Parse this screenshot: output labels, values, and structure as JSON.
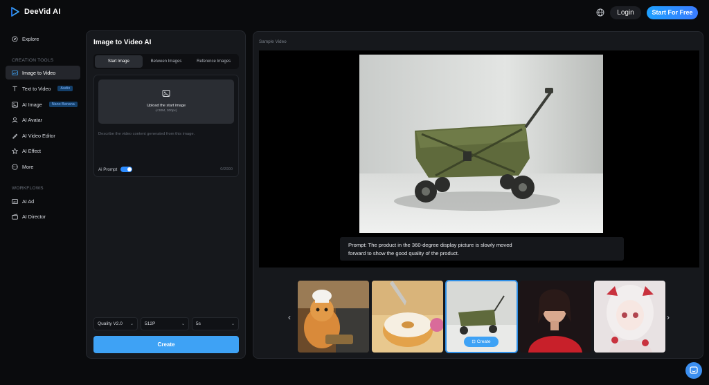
{
  "header": {
    "brand": "DeeVid AI",
    "login_label": "Login",
    "start_label": "Start For Free"
  },
  "sidebar": {
    "explore": "Explore",
    "creation_tools_label": "CREATION TOOLS",
    "items": [
      {
        "label": "Image to Video",
        "icon": "image-video-icon"
      },
      {
        "label": "Text to Video",
        "icon": "text-icon",
        "tag": "Audio"
      },
      {
        "label": "AI Image",
        "icon": "image-icon",
        "tag": "Nano Banana"
      },
      {
        "label": "AI Avatar",
        "icon": "avatar-icon"
      },
      {
        "label": "AI Video Editor",
        "icon": "editor-icon"
      },
      {
        "label": "AI Effect",
        "icon": "effect-icon"
      },
      {
        "label": "More",
        "icon": "more-icon"
      }
    ],
    "workflows_label": "WORKFLOWS",
    "workflows": [
      {
        "label": "AI Ad",
        "icon": "ad-icon"
      },
      {
        "label": "AI Director",
        "icon": "director-icon"
      }
    ]
  },
  "panel": {
    "title": "Image to Video AI",
    "tabs": [
      "Start Image",
      "Between Images",
      "Reference Images"
    ],
    "upload_label": "Upload the start image",
    "upload_sub": "(<30M, 300px)",
    "prompt_placeholder": "Describe the video content generated from this image.",
    "ai_prompt_label": "Ai Prompt",
    "counter": "0/2000",
    "quality": "Quality V2.0",
    "resolution": "512P",
    "duration": "5s",
    "create_label": "Create"
  },
  "sample": {
    "label": "Sample Video",
    "prompt_line1": "Prompt:  The product in the 360-degree display picture is slowly moved",
    "prompt_line2": "forward to show the good quality of the product.",
    "thumb_create_label": "Create"
  },
  "colors": {
    "accent": "#3ea2f5",
    "background": "#0a0b0d",
    "panel": "#16181c"
  }
}
